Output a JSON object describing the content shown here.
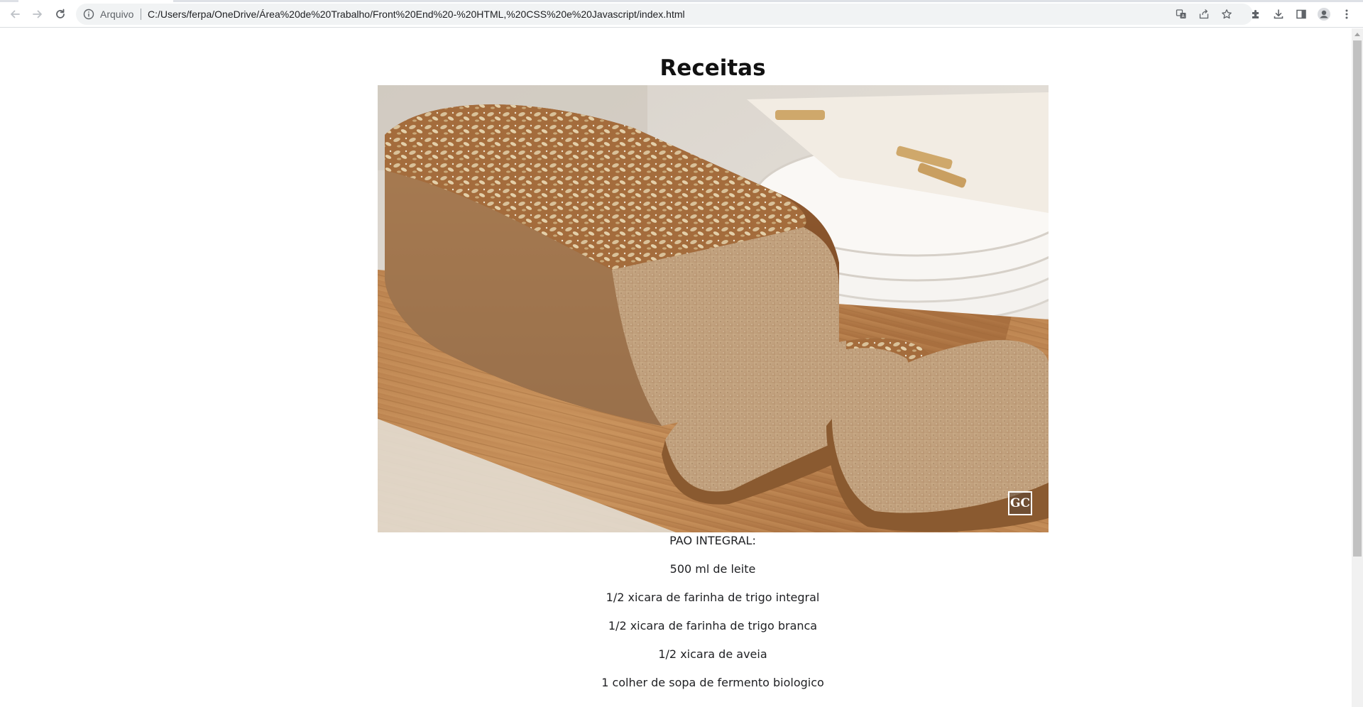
{
  "browser": {
    "address_chip_label": "Arquivo",
    "url": "C:/Users/ferpa/OneDrive/Área%20de%20Trabalho/Front%20End%20-%20HTML,%20CSS%20e%20Javascript/index.html",
    "icons": {
      "back": "back-arrow-icon",
      "forward": "forward-arrow-icon",
      "reload": "reload-icon",
      "site_info": "info-icon",
      "translate": "translate-icon",
      "share": "share-icon",
      "bookmark": "star-icon",
      "extensions": "puzzle-icon",
      "downloads": "download-icon",
      "side_panel": "side-panel-icon",
      "profile": "profile-avatar-icon",
      "menu": "kebab-menu-icon"
    }
  },
  "page": {
    "title": "Receitas",
    "image": {
      "subject": "whole wheat bread loaf with seeds on a wooden board",
      "watermark": "GC"
    },
    "recipe_title": "PAO INTEGRAL:",
    "ingredients": [
      "500 ml de leite",
      "1/2 xicara de farinha de trigo integral",
      "1/2 xicara de farinha de trigo branca",
      "1/2 xicara de aveia",
      "1 colher de sopa de fermento biologico"
    ]
  }
}
